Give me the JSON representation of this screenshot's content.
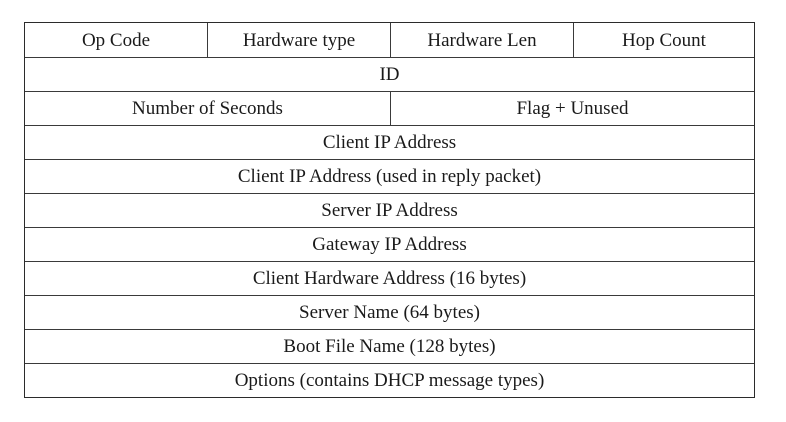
{
  "header_row": {
    "op_code": "Op Code",
    "hardware_type": "Hardware type",
    "hardware_len": "Hardware Len",
    "hop_count": "Hop Count"
  },
  "id_row": {
    "id": "ID"
  },
  "seconds_row": {
    "number_of_seconds": "Number of Seconds",
    "flag_unused": "Flag + Unused"
  },
  "fields": [
    "Client IP Address",
    "Client IP Address (used in reply packet)",
    "Server IP Address",
    "Gateway IP Address",
    "Client Hardware Address (16 bytes)",
    "Server Name (64 bytes)",
    "Boot File Name (128 bytes)",
    "Options (contains DHCP message types)"
  ]
}
